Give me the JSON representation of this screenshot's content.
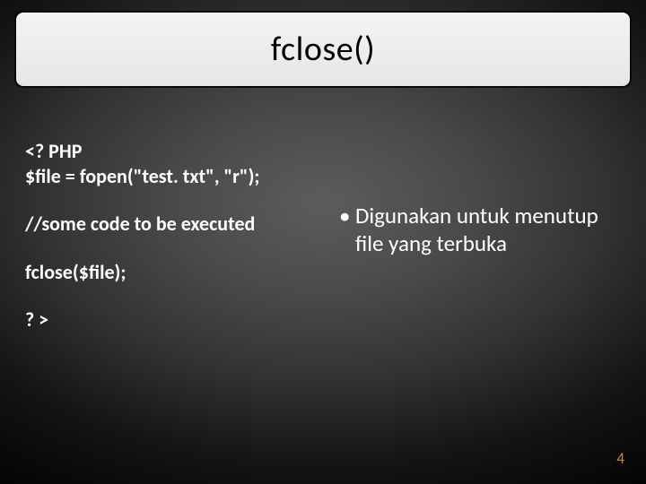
{
  "title": "fclose()",
  "code": {
    "block1": "<? PHP\n$file = fopen(\"test. txt\", \"r\");",
    "block2": "//some code to be executed",
    "block3": "fclose($file);",
    "block4": "? >"
  },
  "bullet": {
    "mark": "•",
    "text": "Digunakan untuk menutup file yang terbuka"
  },
  "page_number": "4"
}
